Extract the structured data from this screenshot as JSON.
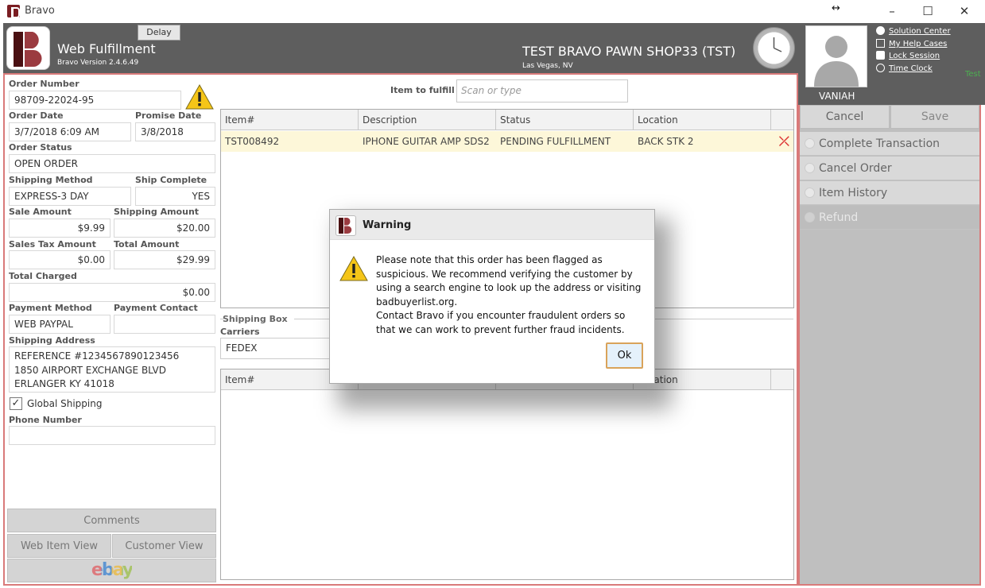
{
  "window": {
    "title": "Bravo"
  },
  "header": {
    "app_name": "Web Fulfillment",
    "version": "Bravo Version 2.4.6.49",
    "delay_label": "Delay",
    "shop_name": "TEST BRAVO PAWN SHOP33 (TST)",
    "shop_location": "Las Vegas, NV"
  },
  "user": {
    "name": "VANIAH",
    "links": [
      "Solution Center",
      "My Help Cases",
      "Lock Session",
      "Time Clock"
    ],
    "side_note": "Test"
  },
  "order": {
    "number_label": "Order Number",
    "number": "98709-22024-95",
    "date_label": "Order Date",
    "date": "3/7/2018 6:09 AM",
    "promise_label": "Promise Date",
    "promise": "3/8/2018",
    "status_label": "Order Status",
    "status": "OPEN ORDER",
    "shipping_method_label": "Shipping Method",
    "shipping_method": "EXPRESS-3 DAY",
    "ship_complete_label": "Ship Complete",
    "ship_complete": "YES",
    "sale_amount_label": "Sale Amount",
    "sale_amount": "$9.99",
    "shipping_amount_label": "Shipping Amount",
    "shipping_amount": "$20.00",
    "tax_label": "Sales Tax Amount",
    "tax": "$0.00",
    "total_label": "Total Amount",
    "total": "$29.99",
    "charged_label": "Total Charged",
    "charged": "$0.00",
    "payment_method_label": "Payment Method",
    "payment_method": "WEB PAYPAL",
    "payment_contact_label": "Payment Contact",
    "payment_contact": "",
    "address_label": "Shipping Address",
    "address_lines": [
      "REFERENCE #1234567890123456",
      "1850 AIRPORT EXCHANGE BLVD",
      "ERLANGER KY 41018"
    ],
    "global_shipping_label": "Global Shipping",
    "phone_label": "Phone Number",
    "phone": ""
  },
  "left_buttons": {
    "comments": "Comments",
    "web_item_view": "Web Item View",
    "customer_view": "Customer View",
    "ebay": "ebay"
  },
  "fulfill": {
    "label": "Item to fulfill",
    "placeholder": "Scan or type"
  },
  "items_grid": {
    "columns": [
      "Item#",
      "Description",
      "Status",
      "Location"
    ],
    "rows": [
      {
        "item": "TST008492",
        "description": "IPHONE GUITAR AMP SDS2",
        "status": "PENDING FULFILLMENT",
        "location": "BACK STK 2"
      }
    ]
  },
  "shipping": {
    "box_label": "Shipping Box",
    "carriers_label": "Carriers",
    "carrier": "FEDEX"
  },
  "box_grid": {
    "columns": [
      "Item#",
      "",
      "",
      "Location"
    ]
  },
  "actions": {
    "cancel": "Cancel",
    "save": "Save",
    "items": [
      "Complete Transaction",
      "Cancel Order",
      "Item History",
      "Refund"
    ]
  },
  "modal": {
    "title": "Warning",
    "paragraph1": "Please note that this order has been flagged as suspicious. We recommend verifying the customer by using a search engine to look up the address or visiting badbuyerlist.org.",
    "paragraph2": "Contact Bravo if you encounter fraudulent orders so that we can work to prevent further fraud incidents.",
    "ok": "Ok"
  },
  "colors": {
    "header_bg": "#5e5e5e",
    "accent_red": "#d97a7a",
    "row_highlight": "#fdf7d9",
    "brand": "#7a1d22"
  }
}
